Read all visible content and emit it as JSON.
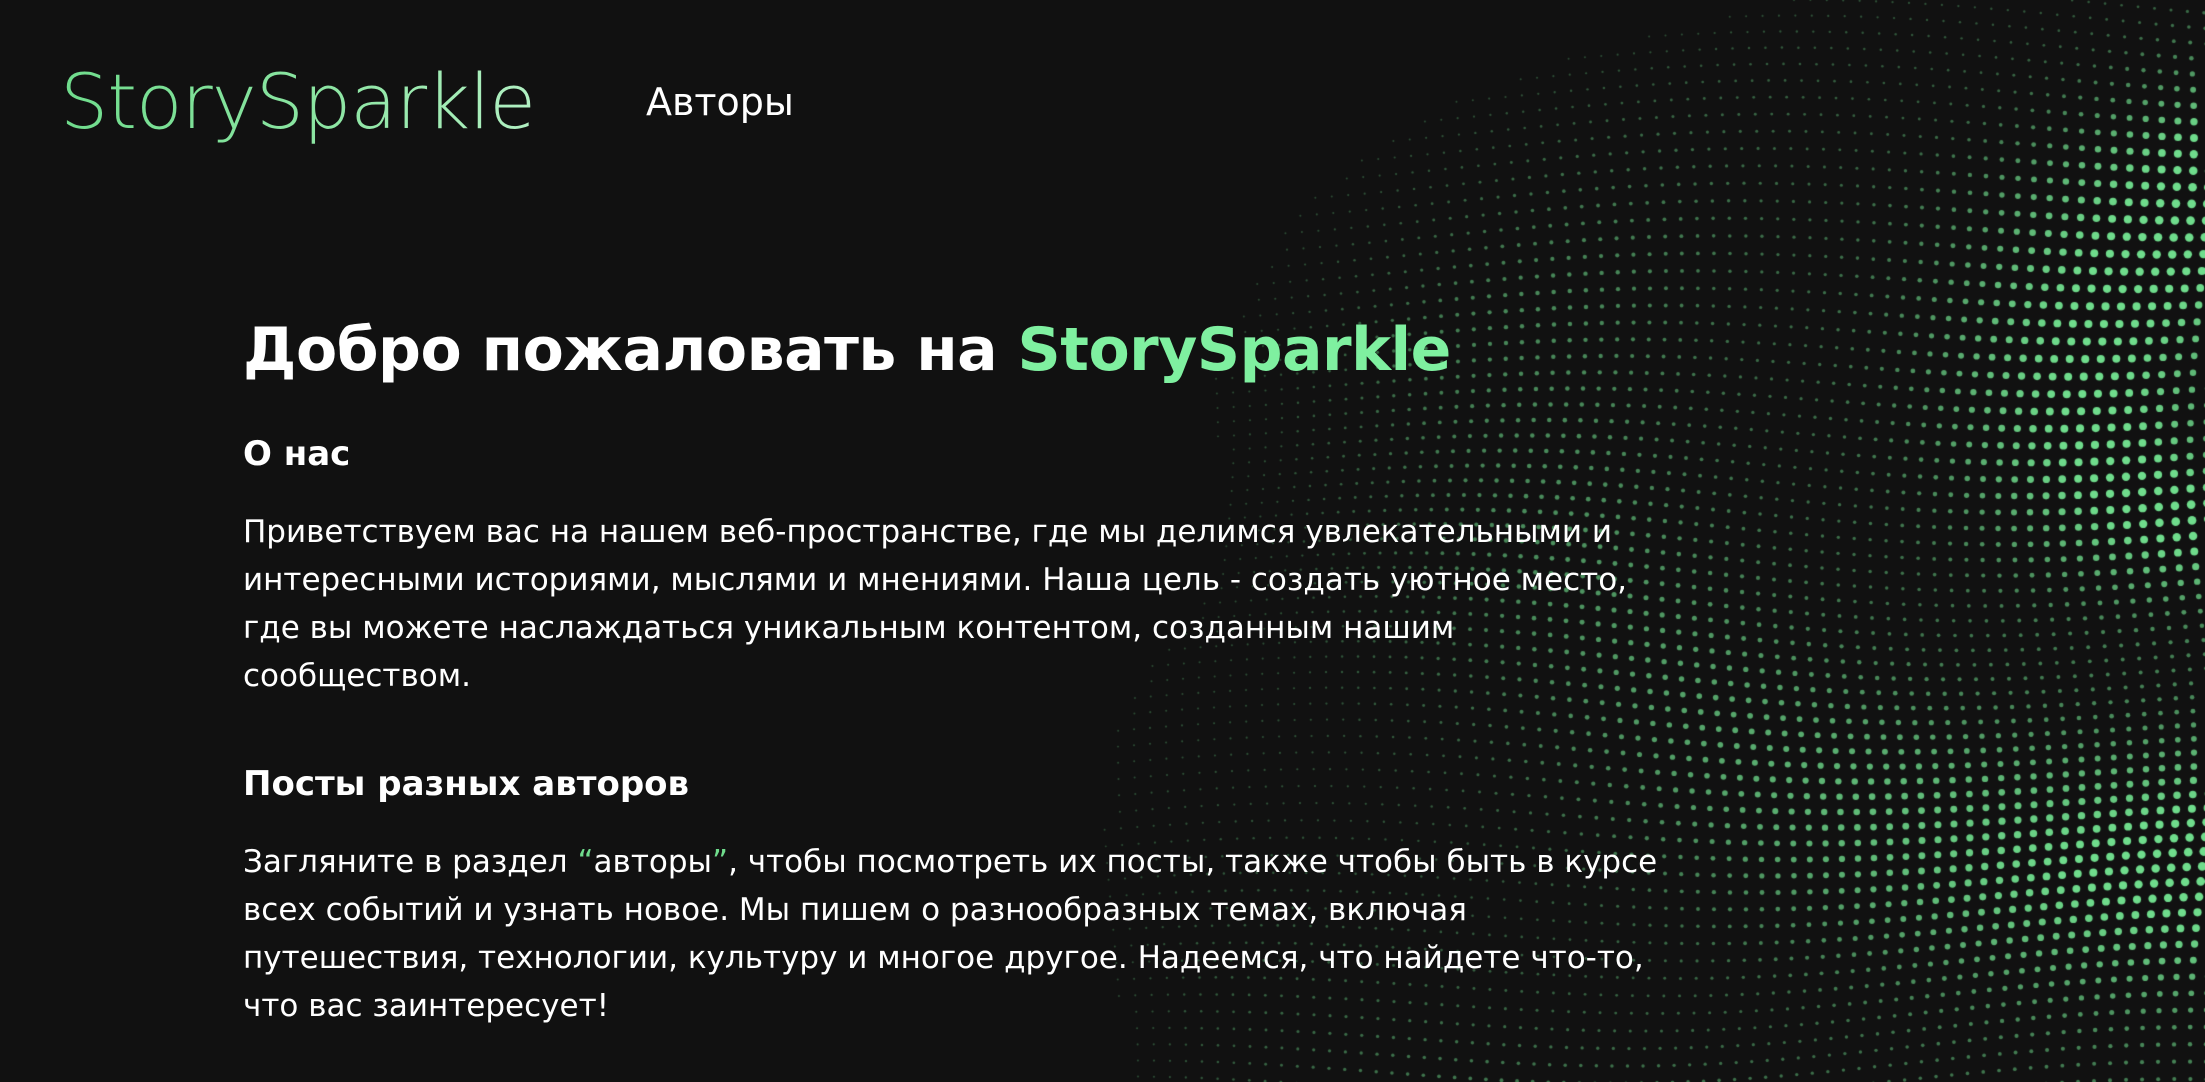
{
  "header": {
    "logo_text": "StorySparkle",
    "nav_authors_label": "Авторы"
  },
  "hero": {
    "title_prefix": "Добро пожаловать на ",
    "title_accent": "StorySparkle"
  },
  "about": {
    "heading": "О нас",
    "lines": [
      "Приветствуем вас на нашем веб-пространстве, где мы делимся увлекательными и",
      "интересными историями, мыслями и мнениями. Наша цель - создать уютное место,",
      "где вы можете наслаждаться уникальным контентом, созданным нашим",
      "сообществом."
    ]
  },
  "posts": {
    "heading": "Посты разных авторов",
    "line1_before": "Загляните в раздел ",
    "line1_quote_open": "“",
    "line1_link": "авторы",
    "line1_quote_close": "”",
    "line1_after": ", чтобы посмотреть их посты, также чтобы быть в курсе",
    "lines_rest": [
      "всех событий и узнать новое. Мы пишем о разнообразных темах, включая",
      "путешествия, технологии, культуру и многое другое. Надеемся, что найдете что-то,",
      "что вас заинтересует!"
    ]
  },
  "colors": {
    "background": "#111111",
    "accent": "#7ff0a0",
    "logo": "#6fdc8c",
    "text": "#ffffff",
    "dots": "#6fdc8c"
  },
  "decor": {
    "background_pattern": "green-dot-wave-pattern"
  }
}
